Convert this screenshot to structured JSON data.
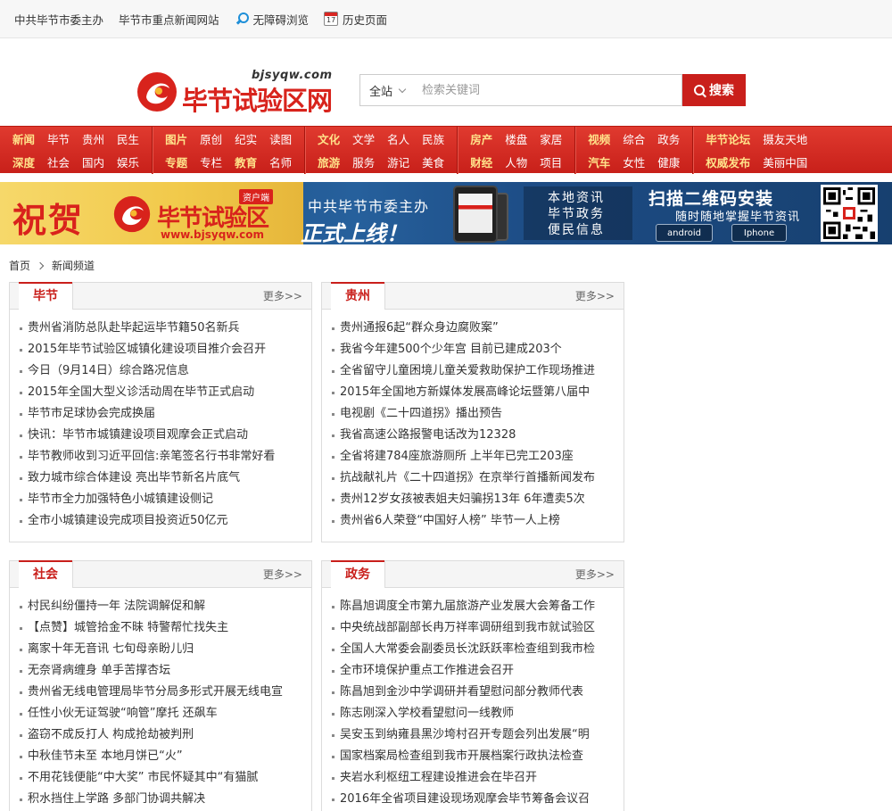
{
  "topbar": {
    "links": [
      "中共毕节市委主办",
      "毕节市重点新闻网站",
      "无障碍浏览",
      "历史页面"
    ],
    "calendar_day": "17"
  },
  "logo": {
    "domain": "bjsyqw.com",
    "name": "毕节试验区网"
  },
  "search": {
    "scope": "全站",
    "placeholder": "检索关键词",
    "button": "搜索"
  },
  "nav": {
    "groups": [
      {
        "row1": [
          {
            "t": "新闻",
            "hl": true
          },
          {
            "t": "毕节"
          },
          {
            "t": "贵州"
          },
          {
            "t": "民生"
          }
        ],
        "row2": [
          {
            "t": "深度",
            "hl": true
          },
          {
            "t": "社会"
          },
          {
            "t": "国内"
          },
          {
            "t": "娱乐"
          }
        ]
      },
      {
        "row1": [
          {
            "t": "图片",
            "hl": true
          },
          {
            "t": "原创"
          },
          {
            "t": "纪实"
          },
          {
            "t": "读图"
          }
        ],
        "row2": [
          {
            "t": "专题",
            "hl": true
          },
          {
            "t": "专栏"
          },
          {
            "t": "教育",
            "hl": true
          },
          {
            "t": "名师"
          }
        ]
      },
      {
        "row1": [
          {
            "t": "文化",
            "hl": true
          },
          {
            "t": "文学"
          },
          {
            "t": "名人"
          },
          {
            "t": "民族"
          }
        ],
        "row2": [
          {
            "t": "旅游",
            "hl": true
          },
          {
            "t": "服务"
          },
          {
            "t": "游记"
          },
          {
            "t": "美食"
          }
        ]
      },
      {
        "row1": [
          {
            "t": "房产",
            "hl": true
          },
          {
            "t": "楼盘"
          },
          {
            "t": "家居"
          }
        ],
        "row2": [
          {
            "t": "财经",
            "hl": true
          },
          {
            "t": "人物"
          },
          {
            "t": "项目"
          }
        ]
      },
      {
        "row1": [
          {
            "t": "视频",
            "hl": true
          },
          {
            "t": "综合"
          },
          {
            "t": "政务"
          }
        ],
        "row2": [
          {
            "t": "汽车",
            "hl": true
          },
          {
            "t": "女性"
          },
          {
            "t": "健康"
          }
        ]
      },
      {
        "row1": [
          {
            "t": "毕节论坛",
            "hl": true
          },
          {
            "t": "摄友天地"
          }
        ],
        "row2": [
          {
            "t": "权威发布",
            "hl": true
          },
          {
            "t": "美丽中国"
          }
        ]
      }
    ]
  },
  "banner": {
    "greeting": "祝贺",
    "logo_name": "毕节试验区",
    "logo_url": "www.bjsyqw.com",
    "tag": "资户端",
    "host": "中共毕节市委主办",
    "launch": "正式上线！",
    "info": [
      "本地资讯",
      "毕节政务",
      "便民信息"
    ],
    "scan_title": "扫描二维码安装",
    "scan_sub": "随时随地掌握毕节资讯",
    "stores": [
      "android",
      "Iphone"
    ]
  },
  "breadcrumb": [
    "首页",
    "新闻频道"
  ],
  "more_label": "更多>>",
  "panels": [
    {
      "title": "毕节",
      "items": [
        "贵州省消防总队赴毕起运毕节籍50名新兵",
        "2015年毕节试验区城镇化建设项目推介会召开",
        "今日（9月14日）综合路况信息",
        "2015年全国大型义诊活动周在毕节正式启动",
        "毕节市足球协会完成换届",
        "快讯：毕节市城镇建设项目观摩会正式启动",
        "毕节教师收到习近平回信:亲笔签名行书非常好看",
        "致力城市综合体建设 亮出毕节新名片底气",
        "毕节市全力加强特色小城镇建设侧记",
        "全市小城镇建设完成项目投资近50亿元"
      ]
    },
    {
      "title": "贵州",
      "items": [
        "贵州通报6起“群众身边腐败案”",
        "我省今年建500个少年宫 目前已建成203个",
        "全省留守儿童困境儿童关爱救助保护工作现场推进",
        "2015年全国地方新媒体发展高峰论坛暨第八届中",
        "电视剧《二十四道拐》播出预告",
        "我省高速公路报警电话改为12328",
        "全省将建784座旅游厕所 上半年已完工203座",
        "抗战献礼片《二十四道拐》在京举行首播新闻发布",
        "贵州12岁女孩被表姐夫妇骗拐13年 6年遭卖5次",
        "贵州省6人荣登“中国好人榜” 毕节一人上榜"
      ]
    },
    {
      "title": "社会",
      "items": [
        "村民纠纷僵持一年 法院调解促和解",
        "【点赞】城管拾金不昧 特警帮忙找失主",
        "离家十年无音讯 七旬母亲盼儿归",
        "无奈肾病缠身 单手苦撑杏坛",
        "贵州省无线电管理局毕节分局多形式开展无线电宣",
        "任性小伙无证驾驶“响管”摩托 还飙车",
        "盗窃不成反打人 构成抢劫被判刑",
        "中秋佳节未至 本地月饼已“火”",
        "不用花钱便能“中大奖” 市民怀疑其中“有猫腻",
        "积水挡住上学路 多部门协调共解决"
      ]
    },
    {
      "title": "政务",
      "items": [
        "陈昌旭调度全市第九届旅游产业发展大会筹备工作",
        "中央统战部副部长冉万祥率调研组到我市就试验区",
        "全国人大常委会副委员长沈跃跃率检查组到我市检",
        "全市环境保护重点工作推进会召开",
        "陈昌旭到金沙中学调研并看望慰问部分教师代表",
        "陈志刚深入学校看望慰问一线教师",
        "吴安玉到纳雍县黑沙垮村召开专题会列出发展“明",
        "国家档案局检查组到我市开展档案行政执法检查",
        "夹岩水利枢纽工程建设推进会在毕召开",
        "2016年全省项目建设现场观摩会毕节筹备会议召"
      ]
    }
  ],
  "colors": {
    "brand_red": "#c91f1b",
    "nav_highlight": "#ffe28a"
  }
}
